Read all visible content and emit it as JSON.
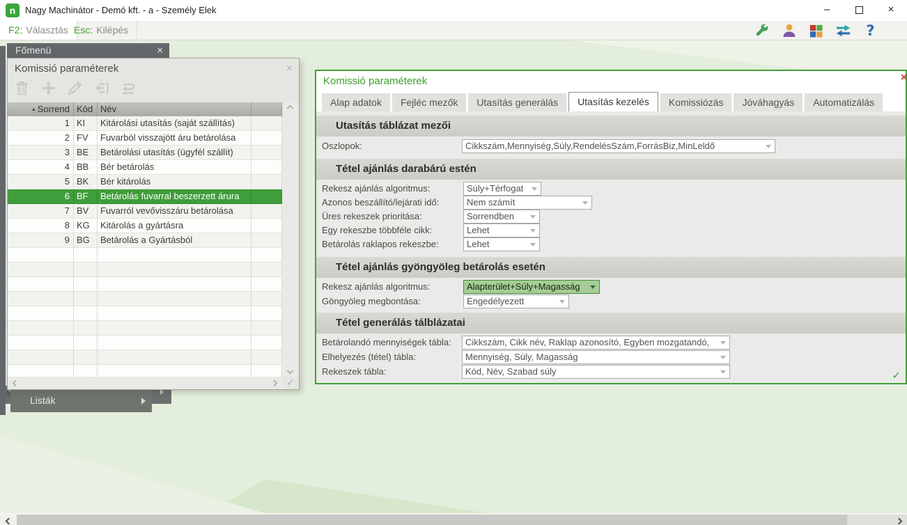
{
  "titlebar": {
    "title": "Nagy Machinátor - Demó kft. - a - Személy Elek",
    "logo_letter": "n"
  },
  "icons": {
    "minimize": "–",
    "close": "×",
    "help": "?",
    "check": "✓",
    "sort_asc": "▲"
  },
  "menubar": {
    "f2_key": "F2:",
    "f2_label": "Választás",
    "esc_key": "Esc:",
    "esc_label": "Kilépés"
  },
  "fomenu": {
    "tab": "Főmenü",
    "menu_item": "Listák"
  },
  "left_window": {
    "title": "Komissió paraméterek",
    "columns": {
      "sorrend": "Sorrend",
      "kod": "Kód",
      "nev": "Név"
    },
    "selected_row_index": 5,
    "rows": [
      {
        "sorrend": "1",
        "kod": "KI",
        "nev": "Kitárolási utasítás (saját szállítás)"
      },
      {
        "sorrend": "2",
        "kod": "FV",
        "nev": "Fuvarból visszajött áru betárolása"
      },
      {
        "sorrend": "3",
        "kod": "BE",
        "nev": "Betárolási utasítás (ügyfél szállít)"
      },
      {
        "sorrend": "4",
        "kod": "BB",
        "nev": "Bér betárolás"
      },
      {
        "sorrend": "5",
        "kod": "BK",
        "nev": "Bér kitárolás"
      },
      {
        "sorrend": "6",
        "kod": "BF",
        "nev": "Betárolás fuvarral beszerzett árura"
      },
      {
        "sorrend": "7",
        "kod": "BV",
        "nev": "Fuvarról vevővisszáru betárolása"
      },
      {
        "sorrend": "8",
        "kod": "KG",
        "nev": "Kitárolás a gyártásra"
      },
      {
        "sorrend": "9",
        "kod": "BG",
        "nev": "Betárolás a Gyártásból"
      }
    ]
  },
  "panel": {
    "title": "Komissió paraméterek",
    "tabs": [
      "Alap adatok",
      "Fejléc mezők",
      "Utasítás generálás",
      "Utasítás kezelés",
      "Komissiózás",
      "Jóváhagyás",
      "Automatizálás"
    ],
    "active_tab": "Utasítás kezelés",
    "sections": {
      "s1": {
        "title": "Utasítás táblázat mezői",
        "f1": {
          "label": "Oszlopok:",
          "value": "Cikkszám,Mennyiség,Súly,RendelésSzám,ForrásBiz,MinLeldő"
        }
      },
      "s2": {
        "title": "Tétel ajánlás darabárú estén",
        "f1": {
          "label": "Rekesz ajánlás algoritmus:",
          "value": "Súly+Térfogat"
        },
        "f2": {
          "label": "Azonos beszállító/lejárati idő:",
          "value": "Nem számít"
        },
        "f3": {
          "label": "Üres rekeszek prioritása:",
          "value": "Sorrendben"
        },
        "f4": {
          "label": "Egy rekeszbe többféle cikk:",
          "value": "Lehet"
        },
        "f5": {
          "label": "Betárolás raklapos rekeszbe:",
          "value": "Lehet"
        }
      },
      "s3": {
        "title": "Tétel ajánlás gyöngyöleg betárolás esetén",
        "f1": {
          "label": "Rekesz ajánlás algoritmus:",
          "value": "Alapterület+Súly+Magasság"
        },
        "f2": {
          "label": "Göngyöleg megbontása:",
          "value": "Engedélyezett"
        }
      },
      "s4": {
        "title": "Tétel generálás tálblázatai",
        "f1": {
          "label": "Betárolandó mennyiségek tábla:",
          "value": "Cikkszám, Cikk név, Raklap azonosító, Egyben mozgatandó,"
        },
        "f2": {
          "label": "Elhelyezés (tétel) tábla:",
          "value": "Mennyiség, Súly, Magasság"
        },
        "f3": {
          "label": "Rekeszek tábla:",
          "value": "Kód, Név, Szabad súly"
        }
      }
    }
  },
  "colors": {
    "accent_green": "#3fa02e",
    "selection_green": "#3f9d3b",
    "focus_field_green": "#a7cd96",
    "close_red": "#c0392b",
    "desktop_green": "#e4eedd"
  }
}
